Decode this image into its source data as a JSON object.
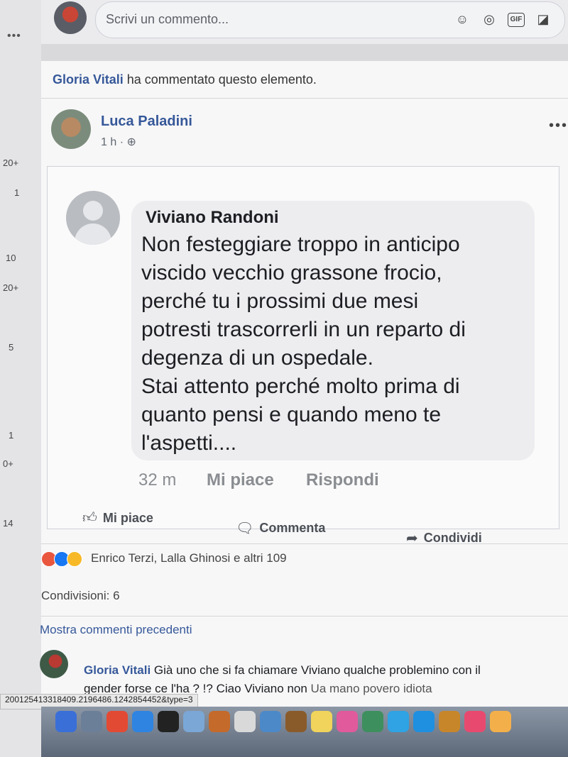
{
  "gutter": {
    "dots": "•••",
    "labels": [
      {
        "text": "20+"
      },
      {
        "text": "1"
      },
      {
        "text": "10"
      },
      {
        "text": "20+"
      },
      {
        "text": "5"
      },
      {
        "text": "1"
      },
      {
        "text": "0+"
      },
      {
        "text": "14"
      }
    ]
  },
  "composer": {
    "placeholder": "Scrivi un commento...",
    "icons": [
      "emoji-icon",
      "camera-icon",
      "gif-icon",
      "sticker-icon"
    ],
    "gif_label": "GIF"
  },
  "post": {
    "shared_by": "Gloria Vitali",
    "shared_suffix": "ha commentato questo elemento.",
    "author": "Luca Paladini",
    "time": "1 h · ⊕",
    "menu": "•••",
    "screenshot": {
      "author": "Viviano Randoni",
      "lines": [
        "Non festeggiare troppo in anticipo",
        "viscido vecchio grassone frocio,",
        "perché tu i prossimi due mesi",
        "potresti trascorrerli in un reparto di",
        "degenza di un ospedale.",
        "Stai attento perché molto prima di",
        "quanto pensi e quando meno te",
        "l'aspetti...."
      ],
      "age": "32 m",
      "like": "Mi piace",
      "reply": "Rispondi"
    },
    "actions": {
      "like": "Mi piace",
      "comment": "Commenta",
      "share": "Condividi"
    },
    "reactions_text": "Enrico Terzi, Lalla Ghinosi e altri 109",
    "reaction_colors": [
      "#e9573f",
      "#1877f2",
      "#f7b928"
    ],
    "shares": "Condivisioni: 6",
    "more_comments": "Mostra commenti precedenti",
    "comment": {
      "author": "Gloria Vitali",
      "text": "Già uno che si fa chiamare Viviano qualche problemino con il gender forse ce l'ha ? !? Ciao Viviano non",
      "truncated": "Ua mano povero idiota"
    }
  },
  "status_url": "200125413318409.2196486.1242854452&type=3",
  "dock": {
    "icon_colors": [
      "#3a6fd8",
      "#6b7f99",
      "#e34a33",
      "#2e84e0",
      "#222",
      "#7aa7d6",
      "#c46a2b",
      "#d9d9d9",
      "#4c89c9",
      "#8a5b2a",
      "#f0d45c",
      "#e05a9c",
      "#3e8f5e",
      "#2fa3e3",
      "#1f8fe0",
      "#c8862b",
      "#e84a6f",
      "#f3b04a"
    ]
  }
}
